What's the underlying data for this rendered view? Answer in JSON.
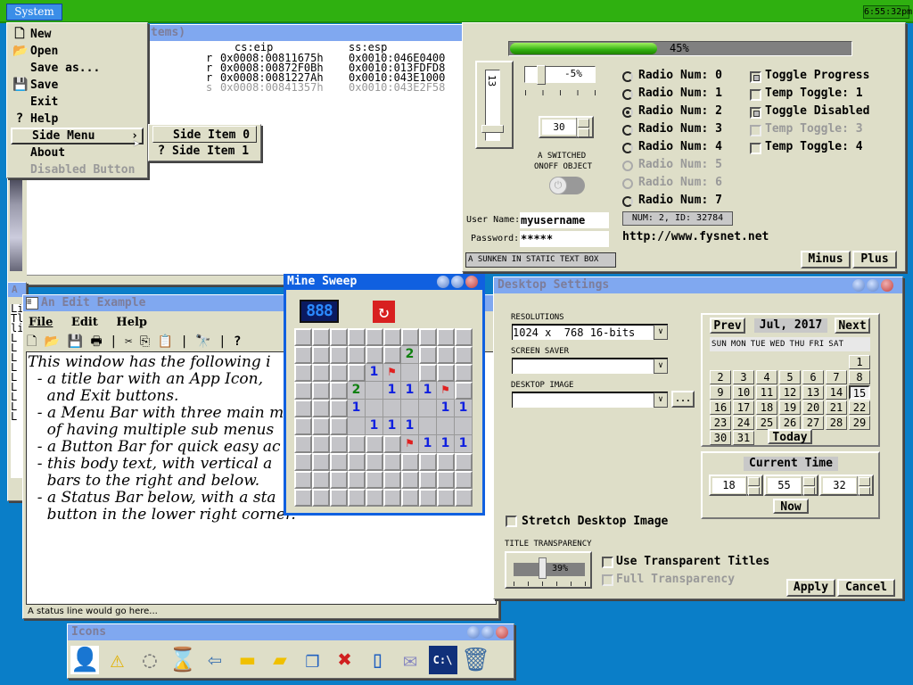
{
  "taskbar": {
    "system_label": "System",
    "clock": "6:55:32pm"
  },
  "debug_window": {
    "title_fragment": "tems)",
    "col_eip": "cs:eip",
    "col_esp": "ss:esp",
    "rows": [
      {
        "type": "r",
        "eip": "0x0008:00811675h",
        "esp": "0x0010:046E0400"
      },
      {
        "type": "r",
        "eip": "0x0008:00872F0Bh",
        "esp": "0x0010:013FDFD8"
      },
      {
        "type": "r",
        "eip": "0x0008:0081227Ah",
        "esp": "0x0010:043E1000"
      },
      {
        "type": "s",
        "eip": "0x0008:00841357h",
        "esp": "0x0010:043E2F58"
      }
    ]
  },
  "system_menu": {
    "items": [
      {
        "label": "New",
        "icon": "new-document-icon"
      },
      {
        "label": "Open",
        "icon": "open-folder-icon"
      },
      {
        "label": "Save as...",
        "icon": ""
      },
      {
        "label": "Save",
        "icon": "floppy-disk-icon"
      },
      {
        "label": "Exit",
        "icon": ""
      },
      {
        "label": "Help",
        "icon": "question-mark-icon"
      },
      {
        "label": "Side Menu",
        "icon": "",
        "submenu": true,
        "highlighted": true
      },
      {
        "label": "About",
        "icon": ""
      },
      {
        "label": "Disabled Button",
        "icon": "",
        "disabled": true
      }
    ],
    "submenu": [
      {
        "label": "Side Item 0",
        "icon": ""
      },
      {
        "label": "Side Item 1",
        "icon": "question-mark-icon"
      }
    ]
  },
  "controls_window": {
    "progress": {
      "value": 45,
      "label": "45%"
    },
    "vslider": {
      "value": "13"
    },
    "hslider": {
      "value": -5,
      "label": "-5%"
    },
    "spinner": "30",
    "switch_caption_1": "A switched",
    "switch_caption_2": "OnOff object",
    "switch_on": false,
    "radios": [
      {
        "label": "Radio Num: 0",
        "selected": false,
        "disabled": false
      },
      {
        "label": "Radio Num: 1",
        "selected": false,
        "disabled": false
      },
      {
        "label": "Radio Num: 2",
        "selected": true,
        "disabled": false
      },
      {
        "label": "Radio Num: 3",
        "selected": false,
        "disabled": false
      },
      {
        "label": "Radio Num: 4",
        "selected": false,
        "disabled": false
      },
      {
        "label": "Radio Num: 5",
        "selected": false,
        "disabled": true
      },
      {
        "label": "Radio Num: 6",
        "selected": false,
        "disabled": true
      },
      {
        "label": "Radio Num: 7",
        "selected": false,
        "disabled": false
      }
    ],
    "checks": [
      {
        "label": "Toggle Progress",
        "checked": true,
        "disabled": false
      },
      {
        "label": "Temp Toggle: 1",
        "checked": false,
        "disabled": false
      },
      {
        "label": "Toggle Disabled",
        "checked": true,
        "disabled": false
      },
      {
        "label": "Temp Toggle: 3",
        "checked": false,
        "disabled": true
      },
      {
        "label": "Temp Toggle: 4",
        "checked": false,
        "disabled": false
      }
    ],
    "username_label": "User Name:",
    "username": "myusername",
    "password_label": "Password:",
    "password": "*****",
    "status_box": "NUM: 2, ID: 32784",
    "url": "http://www.fysnet.net",
    "sunken_text": "A sunken in static text box",
    "minus": "Minus",
    "plus": "Plus"
  },
  "bg_window": {
    "title": "A",
    "lines": [
      "Li",
      "Tl",
      "li",
      "L",
      "L",
      "L",
      "L",
      "L",
      "L",
      "L",
      "L",
      "L"
    ]
  },
  "edit_window": {
    "title": "An Edit Example",
    "menu": [
      "File",
      "Edit",
      "Help"
    ],
    "toolbar_icons": [
      "new-icon",
      "open-icon",
      "save-icon",
      "print-icon",
      "cut-icon",
      "copy-icon",
      "paste-icon",
      "find-icon",
      "help-icon"
    ],
    "text": [
      "This window has the following i",
      "  - a title bar with an App Icon,",
      "    and Exit buttons.",
      "  - a Menu Bar with three main m",
      "    of having multiple sub menus",
      "  - a Button Bar for quick easy ac",
      "  - this body text, with vertical a",
      "    bars to the right and below.",
      "  - a Status Bar below, with a sta",
      "    button in the lower right corner."
    ],
    "status": "A status line would go here..."
  },
  "minesweep": {
    "title": "Mine Sweep",
    "counter": "888",
    "grid": [
      "##########",
      "######2###",
      "####1F.###",
      "###2.111F#",
      "###1....11",
      "###.111...",
      "######F111",
      "##########",
      "##########",
      "##########"
    ]
  },
  "desktop_settings": {
    "title": "Desktop Settings",
    "resolutions_label": "Resolutions",
    "resolution": "1024 x  768 16-bits",
    "screensaver_label": "Screen Saver",
    "screensaver": "",
    "image_label": "Desktop Image",
    "image": "",
    "browse": "...",
    "calendar": {
      "prev": "Prev",
      "next": "Next",
      "month": "Jul, 2017",
      "weekdays": "Sun Mon Tue Wed Thu Fri Sat",
      "first_weekday": 6,
      "days": 31,
      "selected": 15,
      "today": "Today"
    },
    "time": {
      "label": "Current Time",
      "hour": "18",
      "minute": "55",
      "second": "32",
      "now": "Now"
    },
    "stretch": "Stretch Desktop Image",
    "transparency_label": "Title Transparency",
    "transparency": {
      "value": 39,
      "label": "39%"
    },
    "use_transparent": "Use Transparent Titles",
    "full_transparency": "Full Transparency",
    "apply": "Apply",
    "cancel": "Cancel"
  },
  "icons_window": {
    "title": "Icons",
    "icons": [
      {
        "name": "add-user-icon",
        "glyph": "👤",
        "color": "#2060c0"
      },
      {
        "name": "warning-icon",
        "glyph": "⚠",
        "color": "#e0b000"
      },
      {
        "name": "loading-ring-icon",
        "glyph": "◌",
        "color": "#777"
      },
      {
        "name": "hourglass-icon",
        "glyph": "⌛",
        "color": "#333"
      },
      {
        "name": "back-arrow-icon",
        "glyph": "⇦",
        "color": "#3a70b0"
      },
      {
        "name": "folder-icon",
        "glyph": "▬",
        "color": "#f0c000"
      },
      {
        "name": "open-folder-icon",
        "glyph": "▰",
        "color": "#f0c000"
      },
      {
        "name": "copy-icon",
        "glyph": "❐",
        "color": "#2060c0"
      },
      {
        "name": "delete-document-icon",
        "glyph": "✖",
        "color": "#d02020"
      },
      {
        "name": "document-icon",
        "glyph": "▯",
        "color": "#2060c0"
      },
      {
        "name": "mail-icon",
        "glyph": "✉",
        "color": "#8888c0"
      },
      {
        "name": "command-prompt-icon",
        "glyph": "C:\\",
        "color": "#fff"
      },
      {
        "name": "trash-icon",
        "glyph": "🗑",
        "color": "#3a6aa0"
      }
    ]
  },
  "colors": {
    "taskbar": "#2fb010",
    "desktop": "#0a7ec8",
    "title_active": "#1060e0",
    "title_inactive": "#80a8f0",
    "face": "#dedec8"
  }
}
